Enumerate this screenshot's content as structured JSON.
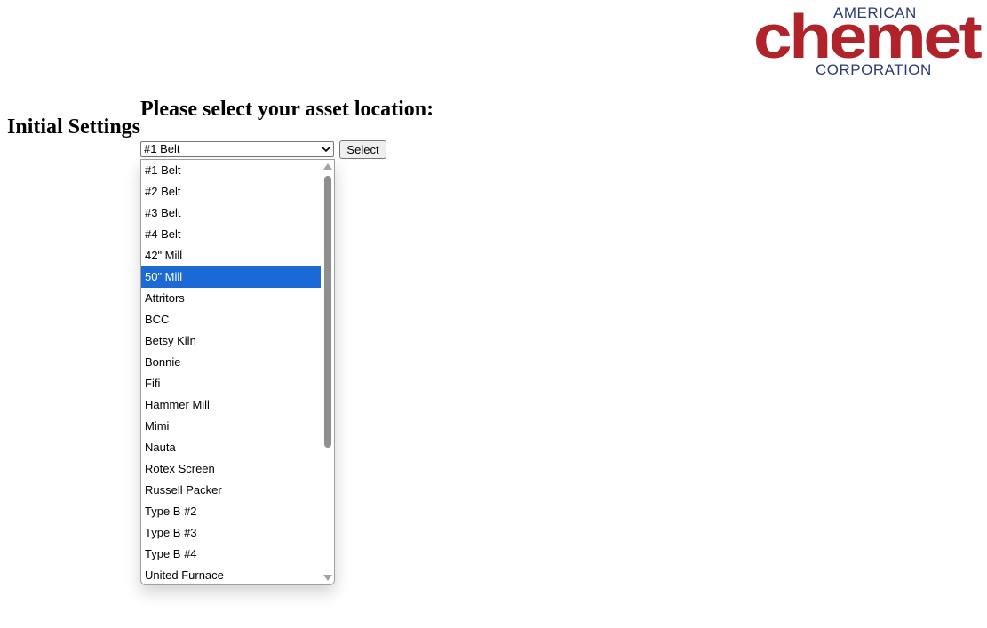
{
  "logo": {
    "top_text": "AMERICAN",
    "main_text": "chemet",
    "bottom_text": "CORPORATION"
  },
  "header": {
    "initial_settings": "Initial Settings",
    "prompt": "Please select your asset location:"
  },
  "location_select": {
    "selected_value": "#1 Belt",
    "button_label": "Select",
    "highlighted_option": "50\" Mill",
    "options": [
      "#1 Belt",
      "#2 Belt",
      "#3 Belt",
      "#4 Belt",
      "42\" Mill",
      "50\" Mill",
      "Attritors",
      "BCC",
      "Betsy Kiln",
      "Bonnie",
      "Fifi",
      "Hammer Mill",
      "Mimi",
      "Nauta",
      "Rotex Screen",
      "Russell Packer",
      "Type B #2",
      "Type B #3",
      "Type B #4",
      "United Furnace"
    ]
  },
  "colors": {
    "brand_red": "#b0232a",
    "brand_navy": "#2b3b74",
    "highlight": "#1a69d4"
  }
}
